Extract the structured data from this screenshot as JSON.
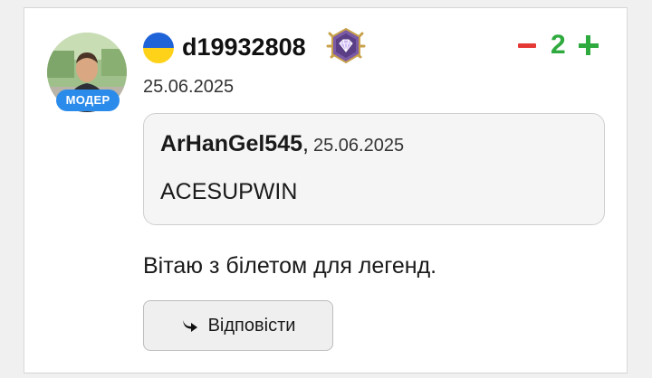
{
  "comment": {
    "author": {
      "username": "d19932808",
      "role_badge": "МОДЕР",
      "flag": "ukraine-flag",
      "rank_icon": "crystal-rank-badge-icon",
      "avatar": "user-avatar-photo"
    },
    "date": "25.06.2025",
    "votes": {
      "score": "2",
      "minus_icon": "minus-icon",
      "plus_icon": "plus-icon"
    },
    "quote": {
      "author": "ArHanGel545",
      "separator": ",",
      "date": "25.06.2025",
      "text": "ACESUPWIN"
    },
    "text": "Вітаю з білетом для легенд.",
    "reply": {
      "label": "Відповісти",
      "icon": "reply-arrow-icon"
    }
  },
  "colors": {
    "mod_badge": "#2a8bea",
    "vote_minus": "#e53935",
    "vote_plus": "#2eaa3e",
    "flag_blue": "#1f63d9",
    "flag_yellow": "#ffd21a"
  }
}
